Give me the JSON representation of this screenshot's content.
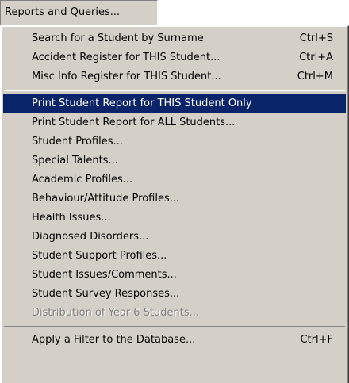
{
  "menubar": {
    "title": "Reports and Queries..."
  },
  "menu": {
    "group1": [
      {
        "label": "Search for a Student by Surname",
        "shortcut": "Ctrl+S"
      },
      {
        "label": "Accident Register for THIS Student...",
        "shortcut": "Ctrl+A"
      },
      {
        "label": "Misc Info Register for THIS Student...",
        "shortcut": "Ctrl+M"
      }
    ],
    "group2": [
      {
        "label": "Print Student Report for THIS Student Only",
        "state": "highlighted"
      },
      {
        "label": "Print Student Report for ALL Students..."
      },
      {
        "label": "Student Profiles..."
      },
      {
        "label": "Special Talents..."
      },
      {
        "label": "Academic Profiles..."
      },
      {
        "label": "Behaviour/Attitude Profiles..."
      },
      {
        "label": "Health Issues..."
      },
      {
        "label": "Diagnosed Disorders..."
      },
      {
        "label": "Student Support Profiles..."
      },
      {
        "label": "Student Issues/Comments..."
      },
      {
        "label": "Student Survey Responses..."
      },
      {
        "label": "Distribution of Year 6 Students...",
        "state": "disabled"
      }
    ],
    "group3": [
      {
        "label": "Apply a Filter to the Database...",
        "shortcut": "Ctrl+F"
      }
    ]
  },
  "colors": {
    "menu_background": "#d4d0c8",
    "highlight_background": "#0a246a",
    "highlight_text": "#ffffff",
    "disabled_text": "#808080"
  }
}
